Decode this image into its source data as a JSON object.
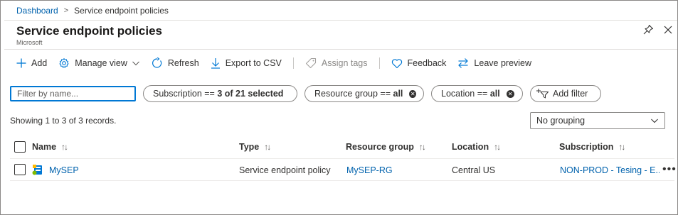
{
  "breadcrumb": {
    "root": "Dashboard",
    "separator": ">",
    "current": "Service endpoint policies"
  },
  "header": {
    "title": "Service endpoint policies",
    "subtitle": "Microsoft"
  },
  "toolbar": {
    "add": "Add",
    "manage_view": "Manage view",
    "refresh": "Refresh",
    "export": "Export to CSV",
    "assign_tags": "Assign tags",
    "feedback": "Feedback",
    "leave_preview": "Leave preview"
  },
  "filters": {
    "placeholder": "Filter by name...",
    "subscription": {
      "label": "Subscription == ",
      "value": "3 of 21 selected"
    },
    "resource_group": {
      "label": "Resource group == ",
      "value": "all"
    },
    "location": {
      "label": "Location == ",
      "value": "all"
    },
    "add_filter": "Add filter"
  },
  "records_text": "Showing 1 to 3 of 3 records.",
  "grouping": {
    "selected": "No grouping"
  },
  "table": {
    "columns": [
      "Name",
      "Type",
      "Resource group",
      "Location",
      "Subscription"
    ],
    "sort_glyph": "↑↓",
    "rows": [
      {
        "name": "MySEP",
        "type": "Service endpoint policy",
        "resource_group": "MySEP-RG",
        "location": "Central US",
        "subscription": "NON-PROD - Tesing - E..."
      }
    ]
  },
  "colors": {
    "accent": "#0078d4",
    "link": "#0062ad",
    "text": "#323130"
  },
  "icons": [
    "plus-icon",
    "gear-icon",
    "chevron-down-icon",
    "refresh-icon",
    "download-icon",
    "tag-icon",
    "heart-icon",
    "swap-icon",
    "filter-icon",
    "pin-icon",
    "close-icon",
    "sort-icon",
    "service-endpoint-policy-icon",
    "more-icon"
  ]
}
